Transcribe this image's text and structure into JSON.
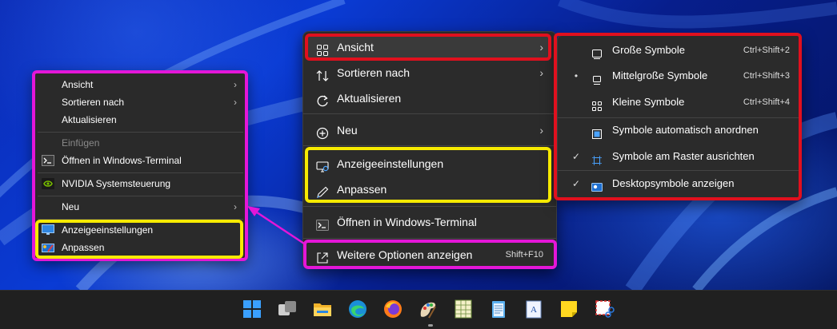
{
  "legacy_menu": {
    "items": [
      {
        "label": "Ansicht",
        "has_submenu": true
      },
      {
        "label": "Sortieren nach",
        "has_submenu": true
      },
      {
        "label": "Aktualisieren"
      },
      {
        "label": "Einfügen",
        "disabled": true
      },
      {
        "label": "Öffnen in Windows-Terminal",
        "icon": "terminal-icon"
      },
      {
        "label": "NVIDIA Systemsteuerung",
        "icon": "nvidia-icon"
      },
      {
        "label": "Neu",
        "has_submenu": true
      },
      {
        "label": "Anzeigeeinstellungen",
        "icon": "display-settings-icon"
      },
      {
        "label": "Anpassen",
        "icon": "personalize-icon"
      }
    ],
    "arrow": "›"
  },
  "main_menu": {
    "items": [
      {
        "label": "Ansicht",
        "icon": "grid-view-icon",
        "has_submenu": true
      },
      {
        "label": "Sortieren nach",
        "icon": "sort-icon",
        "has_submenu": true
      },
      {
        "label": "Aktualisieren",
        "icon": "refresh-icon"
      },
      {
        "label": "Neu",
        "icon": "new-plus-icon",
        "has_submenu": true
      },
      {
        "label": "Anzeigeeinstellungen",
        "icon": "display-settings-icon"
      },
      {
        "label": "Anpassen",
        "icon": "pen-icon"
      },
      {
        "label": "Öffnen in Windows-Terminal",
        "icon": "terminal-icon"
      },
      {
        "label": "Weitere Optionen anzeigen",
        "icon": "more-options-icon",
        "shortcut": "Shift+F10"
      }
    ],
    "arrow": "›"
  },
  "view_submenu": {
    "items": [
      {
        "label": "Große Symbole",
        "icon": "large-icons-icon",
        "shortcut": "Ctrl+Shift+2",
        "mark": ""
      },
      {
        "label": "Mittelgroße Symbole",
        "icon": "medium-icons-icon",
        "shortcut": "Ctrl+Shift+3",
        "mark": "•"
      },
      {
        "label": "Kleine Symbole",
        "icon": "small-icons-icon",
        "shortcut": "Ctrl+Shift+4",
        "mark": ""
      },
      {
        "label": "Symbole automatisch anordnen",
        "icon": "auto-arrange-icon",
        "mark": ""
      },
      {
        "label": "Symbole am Raster ausrichten",
        "icon": "align-grid-icon",
        "mark": "✓"
      },
      {
        "label": "Desktopsymbole anzeigen",
        "icon": "show-desktop-icons-icon",
        "mark": "✓"
      }
    ]
  },
  "taskbar": {
    "icons": [
      "windows-start-icon",
      "task-view-icon",
      "file-explorer-icon",
      "edge-icon",
      "firefox-icon",
      "paint-icon",
      "spreadsheet-icon",
      "notepad-icon",
      "wordpad-icon",
      "sticky-notes-icon",
      "snipping-tool-icon"
    ]
  },
  "colors": {
    "highlight_red": "#e0101e",
    "highlight_yellow": "#f7ea00",
    "highlight_magenta": "#e416d8",
    "menu_bg": "#2b2b2b",
    "taskbar_bg": "#202020"
  }
}
